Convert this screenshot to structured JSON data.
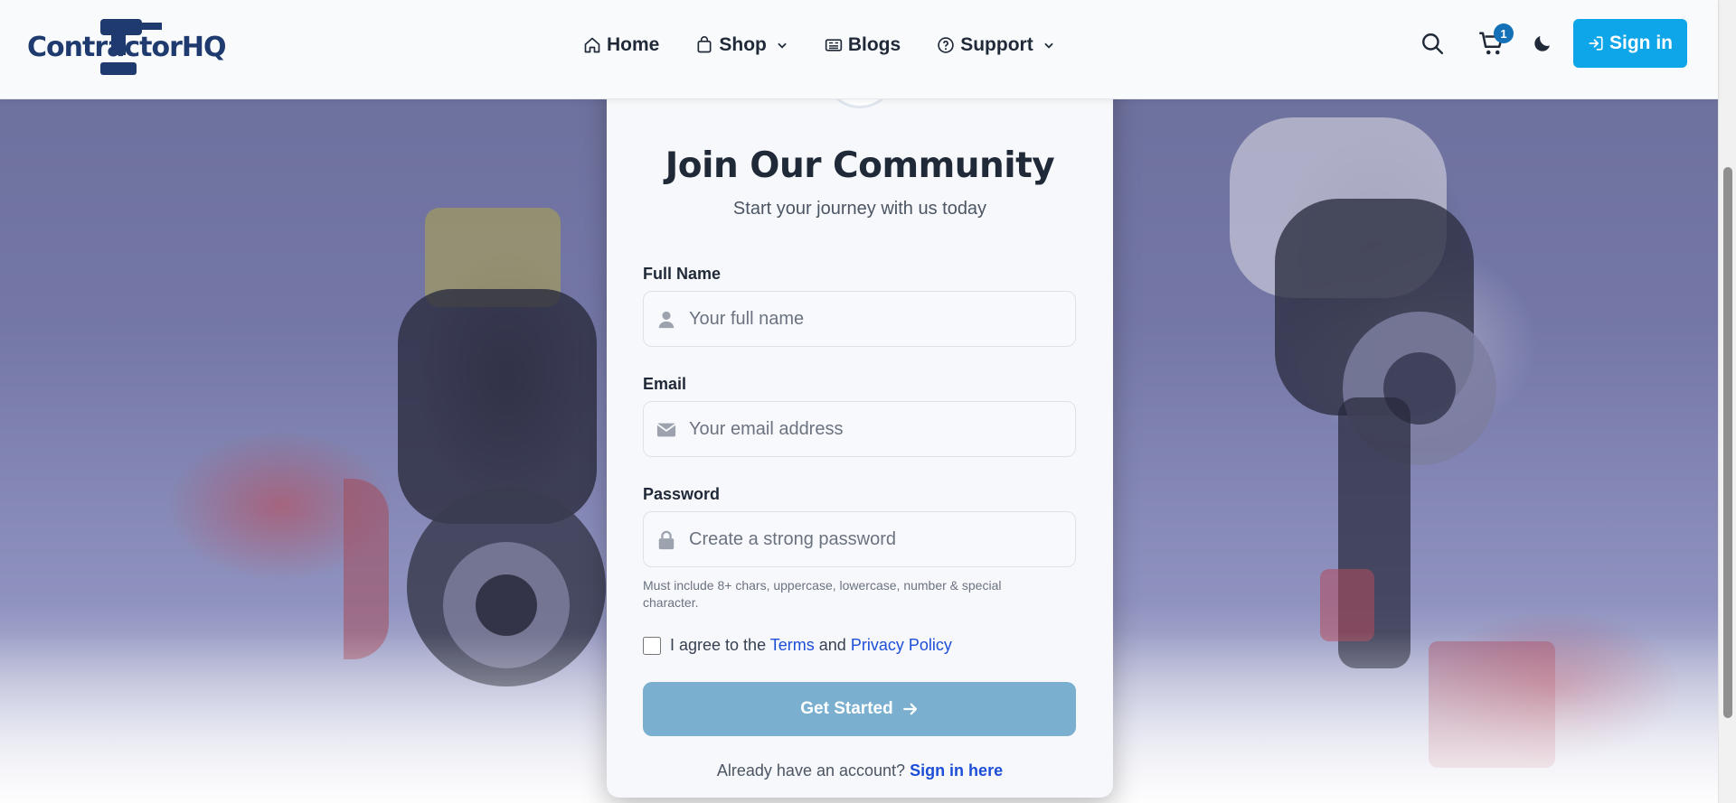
{
  "brand": {
    "logo_text": "ContractorHQ",
    "primary_color": "#0ea5e9",
    "navy_color": "#1e3a6e"
  },
  "nav": {
    "items": [
      {
        "label": "Home",
        "icon": "home-icon"
      },
      {
        "label": "Shop",
        "icon": "shopping-bag-icon",
        "dropdown": true
      },
      {
        "label": "Blogs",
        "icon": "newspaper-icon"
      },
      {
        "label": "Support",
        "icon": "help-circle-icon",
        "dropdown": true
      }
    ]
  },
  "header": {
    "cart_count": "1",
    "signin_label": "Sign in",
    "icons": [
      "search-icon",
      "cart-icon",
      "moon-icon",
      "sign-in-icon"
    ]
  },
  "signup": {
    "title": "Join Our Community",
    "subtitle": "Start your journey with us today",
    "full_name_label": "Full Name",
    "full_name_placeholder": "Your full name",
    "email_label": "Email",
    "email_placeholder": "Your email address",
    "password_label": "Password",
    "password_placeholder": "Create a strong password",
    "password_hint": "Must include 8+ chars, uppercase, lowercase, number & special character.",
    "terms_prefix": "I agree to the",
    "terms_link": "Terms",
    "terms_and": "and",
    "privacy_link": "Privacy Policy",
    "submit_label": "Get Started",
    "already_text": "Already have an account?",
    "signin_link": "Sign in here"
  }
}
